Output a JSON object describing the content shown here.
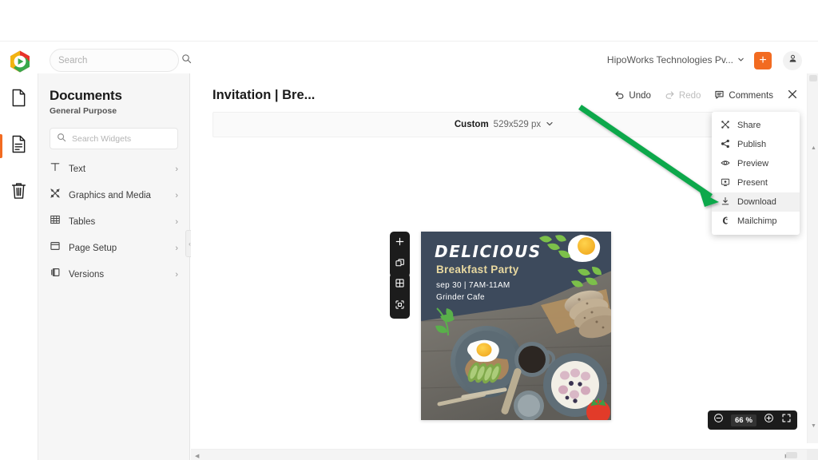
{
  "topbar": {
    "logo_icon": "hexagon-play-logo",
    "search": {
      "placeholder": "Search",
      "value": "",
      "icon": "search-icon"
    },
    "org_label": "HipoWorks Technologies Pv...",
    "org_chevron_icon": "chevron-down-icon",
    "add_label": "+",
    "add_icon": "plus-icon",
    "avatar_icon": "user-avatar-icon"
  },
  "rail": {
    "items": [
      {
        "name": "new-document",
        "icon": "document-blank-icon",
        "active": false
      },
      {
        "name": "documents",
        "icon": "document-lines-icon",
        "active": true
      },
      {
        "name": "trash",
        "icon": "trash-icon",
        "active": false
      }
    ]
  },
  "panel": {
    "title": "Documents",
    "subtitle": "General Purpose",
    "search": {
      "placeholder": "Search Widgets",
      "value": "",
      "icon": "search-icon"
    },
    "widgets": [
      {
        "label": "Text",
        "icon": "text-t-icon",
        "chevron": "›"
      },
      {
        "label": "Graphics and Media",
        "icon": "graphics-media-icon",
        "chevron": "›"
      },
      {
        "label": "Tables",
        "icon": "table-grid-icon",
        "chevron": "›"
      },
      {
        "label": "Page Setup",
        "icon": "page-setup-icon",
        "chevron": "›"
      },
      {
        "label": "Versions",
        "icon": "versions-layers-icon",
        "chevron": "›"
      }
    ],
    "collapse_icon": "chevron-left-icon"
  },
  "editor": {
    "doc_title": "Invitation | Bre...",
    "actions": [
      {
        "label": "Undo",
        "icon": "undo-arrow-icon",
        "disabled": false
      },
      {
        "label": "Redo",
        "icon": "redo-arrow-icon",
        "disabled": true
      },
      {
        "label": "Comments",
        "icon": "comment-bubble-icon",
        "disabled": false
      },
      {
        "label": "",
        "icon": "close-x-icon",
        "disabled": false
      }
    ],
    "size_bar": {
      "mode": "Custom",
      "dimensions": "529x529 px",
      "chevron_icon": "chevron-down-icon"
    },
    "pods": [
      {
        "name": "add-pod",
        "icons": [
          "plus-icon",
          "duplicate-layers-icon"
        ]
      },
      {
        "name": "grid-pod",
        "icons": [
          "grid-icon",
          "crop-selection-icon"
        ]
      }
    ],
    "zoom": {
      "minus_icon": "minus-circle-icon",
      "value": "66",
      "unit": "%",
      "plus_icon": "plus-circle-icon",
      "fullscreen_icon": "fullscreen-expand-icon"
    }
  },
  "design": {
    "title": "DELICIOUS",
    "subtitle": "Breakfast Party",
    "line1": "sep 30 | 7AM-11AM",
    "line2": "Grinder Cafe",
    "colors": {
      "header_bg": "#3d4a5c",
      "subtitle": "#e9d9a0",
      "title": "#ffffff"
    }
  },
  "menu": {
    "items": [
      {
        "label": "Share",
        "icon": "share-nodes-icon",
        "highlighted": false
      },
      {
        "label": "Publish",
        "icon": "share-arrow-icon",
        "highlighted": false
      },
      {
        "label": "Preview",
        "icon": "eye-icon",
        "highlighted": false
      },
      {
        "label": "Present",
        "icon": "present-screen-icon",
        "highlighted": false
      },
      {
        "label": "Download",
        "icon": "download-arrow-icon",
        "highlighted": true
      },
      {
        "label": "Mailchimp",
        "icon": "mailchimp-icon",
        "highlighted": false
      }
    ]
  },
  "annotation": {
    "arrow_color": "#11a84b",
    "points_to": "Download"
  }
}
